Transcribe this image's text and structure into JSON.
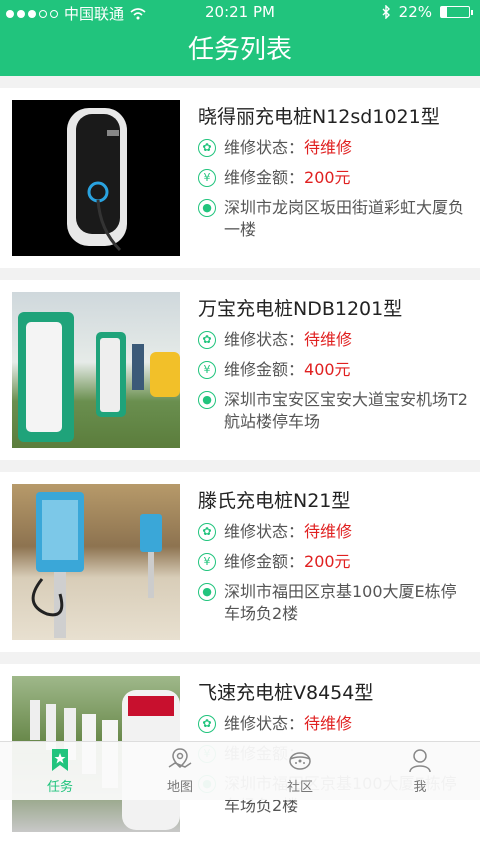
{
  "status_bar": {
    "carrier": "中国联通",
    "time": "20:21 PM",
    "battery": "22%",
    "battery_level": 0.22
  },
  "header": {
    "title": "任务列表"
  },
  "labels": {
    "status_label": "维修状态：",
    "amount_label": "维修金额："
  },
  "tasks": [
    {
      "name": "晓得丽充电桩N12sd1021型",
      "status": "待维修",
      "amount": "200元",
      "address": "深圳市龙岗区坂田街道彩虹大厦负一楼"
    },
    {
      "name": "万宝充电桩NDB1201型",
      "status": "待维修",
      "amount": "400元",
      "address": "深圳市宝安区宝安大道宝安机场T2航站楼停车场"
    },
    {
      "name": "滕氏充电桩N21型",
      "status": "待维修",
      "amount": "200元",
      "address": "深圳市福田区京基100大厦E栋停车场负2楼"
    },
    {
      "name": "飞速充电桩V8454型",
      "status": "待维修",
      "amount": "",
      "address": "深圳市福田区京基100大厦E栋停车场负2楼"
    }
  ],
  "tabbar": {
    "tabs": [
      {
        "label": "任务",
        "icon": "task-icon",
        "active": true
      },
      {
        "label": "地图",
        "icon": "map-icon",
        "active": false
      },
      {
        "label": "社区",
        "icon": "community-icon",
        "active": false
      },
      {
        "label": "我",
        "icon": "profile-icon",
        "active": false
      }
    ]
  },
  "colors": {
    "accent": "#21c47d",
    "alert": "#e02020"
  }
}
